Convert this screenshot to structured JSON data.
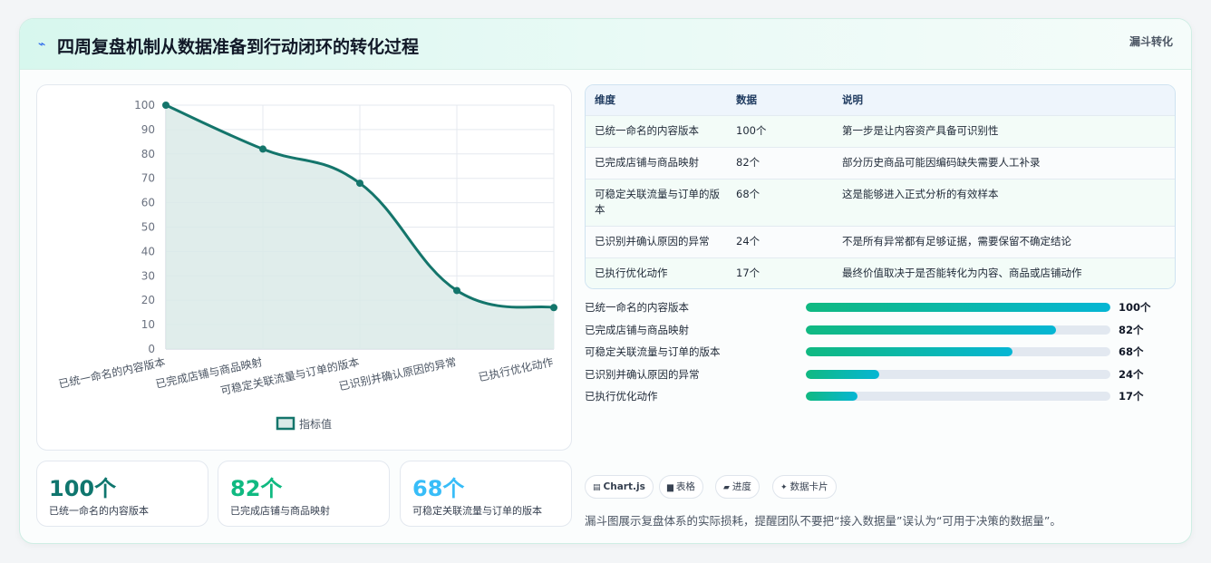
{
  "header": {
    "icon": "lightning-icon",
    "title": "四周复盘机制从数据准备到行动闭环的转化过程",
    "tag": "漏斗转化"
  },
  "chart_data": {
    "type": "area",
    "categories": [
      "已统一命名的内容版本",
      "已完成店铺与商品映射",
      "可稳定关联流量与订单的版本",
      "已识别并确认原因的异常",
      "已执行优化动作"
    ],
    "series": [
      {
        "name": "指标值",
        "values": [
          100,
          82,
          68,
          24,
          17
        ]
      }
    ],
    "ylim": [
      0,
      100
    ],
    "yticks": [
      "0",
      "10",
      "20",
      "30",
      "40",
      "50",
      "60",
      "70",
      "80",
      "90",
      "100"
    ],
    "grid": true,
    "legend": "bottom",
    "colors": {
      "line": "#14756b",
      "fill": "#dbeae8"
    }
  },
  "kpis": [
    {
      "value": "100个",
      "label": "已统一命名的内容版本",
      "color": "#0f766e"
    },
    {
      "value": "82个",
      "label": "已完成店铺与商品映射",
      "color": "#10b981"
    },
    {
      "value": "68个",
      "label": "可稳定关联流量与订单的版本",
      "color": "#38bdf8"
    }
  ],
  "table": {
    "headers": [
      "维度",
      "数据",
      "说明"
    ],
    "rows": [
      {
        "dim": "已统一命名的内容版本",
        "data": "100个",
        "note": "第一步是让内容资产具备可识别性"
      },
      {
        "dim": "已完成店铺与商品映射",
        "data": "82个",
        "note": "部分历史商品可能因编码缺失需要人工补录"
      },
      {
        "dim": "可稳定关联流量与订单的版本",
        "data": "68个",
        "note": "这是能够进入正式分析的有效样本"
      },
      {
        "dim": "已识别并确认原因的异常",
        "data": "24个",
        "note": "不是所有异常都有足够证据，需要保留不确定结论"
      },
      {
        "dim": "已执行优化动作",
        "data": "17个",
        "note": "最终价值取决于是否能转化为内容、商品或店铺动作"
      }
    ]
  },
  "progress": [
    {
      "label": "已统一命名的内容版本",
      "value": "100个",
      "percent": 100
    },
    {
      "label": "已完成店铺与商品映射",
      "value": "82个",
      "percent": 82
    },
    {
      "label": "可稳定关联流量与订单的版本",
      "value": "68个",
      "percent": 68
    },
    {
      "label": "已识别并确认原因的异常",
      "value": "24个",
      "percent": 24
    },
    {
      "label": "已执行优化动作",
      "value": "17个",
      "percent": 17
    }
  ],
  "chips": [
    {
      "icon": "grid-icon",
      "glyph": "▤",
      "label": "Chart.js"
    },
    {
      "icon": "table-icon",
      "glyph": "▆",
      "label": "表格"
    },
    {
      "icon": "progress-icon",
      "glyph": "▰",
      "label": "进度"
    },
    {
      "icon": "sparkle-icon",
      "glyph": "✦",
      "label": "数据卡片"
    }
  ],
  "footer_note": "漏斗图展示复盘体系的实际损耗，提醒团队不要把“接入数据量”误认为“可用于决策的数据量”。"
}
